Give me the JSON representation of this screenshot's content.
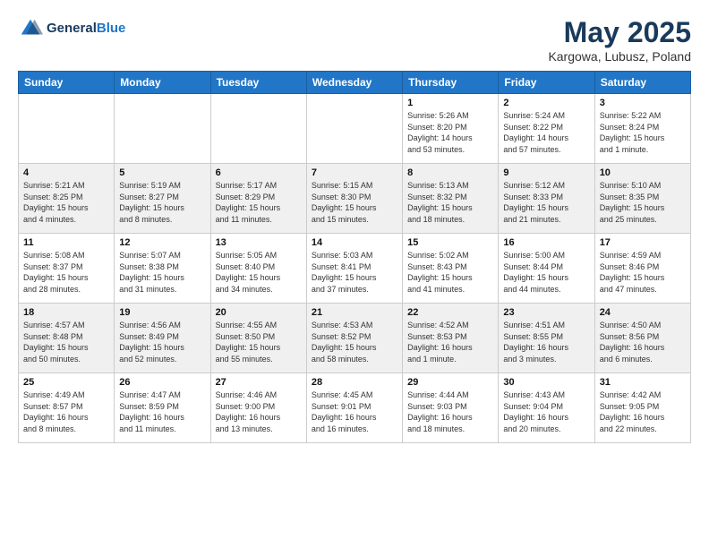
{
  "header": {
    "logo_line1": "General",
    "logo_line2": "Blue",
    "month": "May 2025",
    "location": "Kargowa, Lubusz, Poland"
  },
  "weekdays": [
    "Sunday",
    "Monday",
    "Tuesday",
    "Wednesday",
    "Thursday",
    "Friday",
    "Saturday"
  ],
  "weeks": [
    [
      {
        "day": "",
        "info": ""
      },
      {
        "day": "",
        "info": ""
      },
      {
        "day": "",
        "info": ""
      },
      {
        "day": "",
        "info": ""
      },
      {
        "day": "1",
        "info": "Sunrise: 5:26 AM\nSunset: 8:20 PM\nDaylight: 14 hours\nand 53 minutes."
      },
      {
        "day": "2",
        "info": "Sunrise: 5:24 AM\nSunset: 8:22 PM\nDaylight: 14 hours\nand 57 minutes."
      },
      {
        "day": "3",
        "info": "Sunrise: 5:22 AM\nSunset: 8:24 PM\nDaylight: 15 hours\nand 1 minute."
      }
    ],
    [
      {
        "day": "4",
        "info": "Sunrise: 5:21 AM\nSunset: 8:25 PM\nDaylight: 15 hours\nand 4 minutes."
      },
      {
        "day": "5",
        "info": "Sunrise: 5:19 AM\nSunset: 8:27 PM\nDaylight: 15 hours\nand 8 minutes."
      },
      {
        "day": "6",
        "info": "Sunrise: 5:17 AM\nSunset: 8:29 PM\nDaylight: 15 hours\nand 11 minutes."
      },
      {
        "day": "7",
        "info": "Sunrise: 5:15 AM\nSunset: 8:30 PM\nDaylight: 15 hours\nand 15 minutes."
      },
      {
        "day": "8",
        "info": "Sunrise: 5:13 AM\nSunset: 8:32 PM\nDaylight: 15 hours\nand 18 minutes."
      },
      {
        "day": "9",
        "info": "Sunrise: 5:12 AM\nSunset: 8:33 PM\nDaylight: 15 hours\nand 21 minutes."
      },
      {
        "day": "10",
        "info": "Sunrise: 5:10 AM\nSunset: 8:35 PM\nDaylight: 15 hours\nand 25 minutes."
      }
    ],
    [
      {
        "day": "11",
        "info": "Sunrise: 5:08 AM\nSunset: 8:37 PM\nDaylight: 15 hours\nand 28 minutes."
      },
      {
        "day": "12",
        "info": "Sunrise: 5:07 AM\nSunset: 8:38 PM\nDaylight: 15 hours\nand 31 minutes."
      },
      {
        "day": "13",
        "info": "Sunrise: 5:05 AM\nSunset: 8:40 PM\nDaylight: 15 hours\nand 34 minutes."
      },
      {
        "day": "14",
        "info": "Sunrise: 5:03 AM\nSunset: 8:41 PM\nDaylight: 15 hours\nand 37 minutes."
      },
      {
        "day": "15",
        "info": "Sunrise: 5:02 AM\nSunset: 8:43 PM\nDaylight: 15 hours\nand 41 minutes."
      },
      {
        "day": "16",
        "info": "Sunrise: 5:00 AM\nSunset: 8:44 PM\nDaylight: 15 hours\nand 44 minutes."
      },
      {
        "day": "17",
        "info": "Sunrise: 4:59 AM\nSunset: 8:46 PM\nDaylight: 15 hours\nand 47 minutes."
      }
    ],
    [
      {
        "day": "18",
        "info": "Sunrise: 4:57 AM\nSunset: 8:48 PM\nDaylight: 15 hours\nand 50 minutes."
      },
      {
        "day": "19",
        "info": "Sunrise: 4:56 AM\nSunset: 8:49 PM\nDaylight: 15 hours\nand 52 minutes."
      },
      {
        "day": "20",
        "info": "Sunrise: 4:55 AM\nSunset: 8:50 PM\nDaylight: 15 hours\nand 55 minutes."
      },
      {
        "day": "21",
        "info": "Sunrise: 4:53 AM\nSunset: 8:52 PM\nDaylight: 15 hours\nand 58 minutes."
      },
      {
        "day": "22",
        "info": "Sunrise: 4:52 AM\nSunset: 8:53 PM\nDaylight: 16 hours\nand 1 minute."
      },
      {
        "day": "23",
        "info": "Sunrise: 4:51 AM\nSunset: 8:55 PM\nDaylight: 16 hours\nand 3 minutes."
      },
      {
        "day": "24",
        "info": "Sunrise: 4:50 AM\nSunset: 8:56 PM\nDaylight: 16 hours\nand 6 minutes."
      }
    ],
    [
      {
        "day": "25",
        "info": "Sunrise: 4:49 AM\nSunset: 8:57 PM\nDaylight: 16 hours\nand 8 minutes."
      },
      {
        "day": "26",
        "info": "Sunrise: 4:47 AM\nSunset: 8:59 PM\nDaylight: 16 hours\nand 11 minutes."
      },
      {
        "day": "27",
        "info": "Sunrise: 4:46 AM\nSunset: 9:00 PM\nDaylight: 16 hours\nand 13 minutes."
      },
      {
        "day": "28",
        "info": "Sunrise: 4:45 AM\nSunset: 9:01 PM\nDaylight: 16 hours\nand 16 minutes."
      },
      {
        "day": "29",
        "info": "Sunrise: 4:44 AM\nSunset: 9:03 PM\nDaylight: 16 hours\nand 18 minutes."
      },
      {
        "day": "30",
        "info": "Sunrise: 4:43 AM\nSunset: 9:04 PM\nDaylight: 16 hours\nand 20 minutes."
      },
      {
        "day": "31",
        "info": "Sunrise: 4:42 AM\nSunset: 9:05 PM\nDaylight: 16 hours\nand 22 minutes."
      }
    ]
  ]
}
